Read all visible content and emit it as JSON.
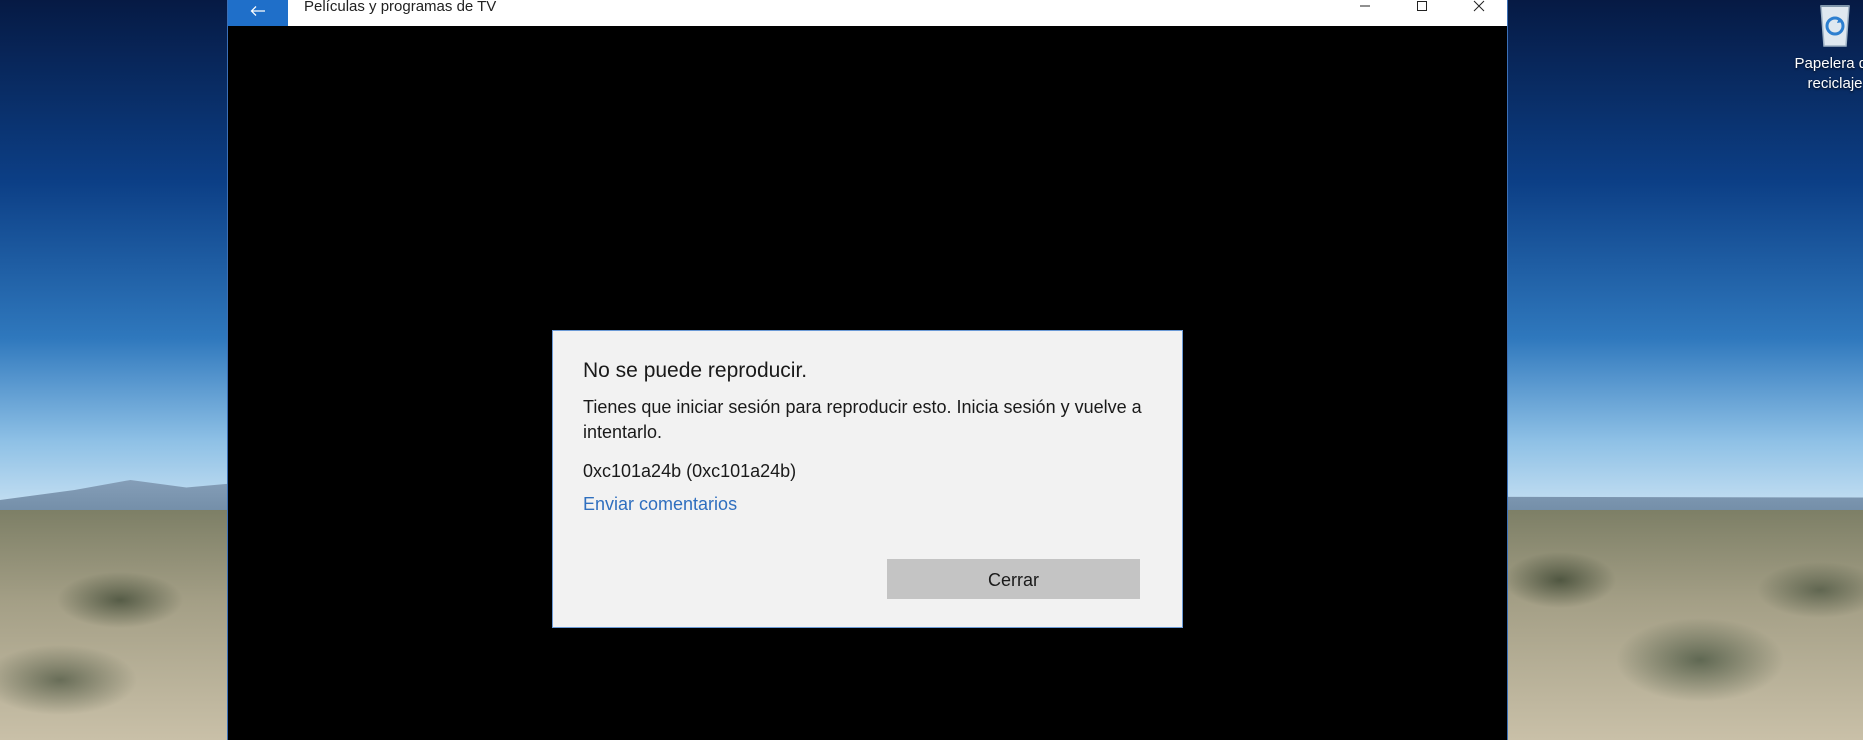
{
  "window": {
    "title": "Películas y programas de TV",
    "accent_color": "#1f6fc9"
  },
  "titlebar": {
    "back_icon": "arrow-left-icon",
    "controls": [
      "minimize-icon",
      "maximize-icon",
      "close-icon"
    ]
  },
  "dialog": {
    "title": "No se puede reproducir.",
    "message": "Tienes que iniciar sesión para reproducir esto. Inicia sesión y vuelve a intentarlo.",
    "error_code": "0xc101a24b (0xc101a24b)",
    "feedback_link": "Enviar comentarios",
    "close_button": "Cerrar",
    "link_color": "#2f6fbf"
  },
  "desktop": {
    "recycle_bin_label": "Papelera de reciclaje",
    "recycle_bin_icon": "recycle-bin-icon"
  }
}
